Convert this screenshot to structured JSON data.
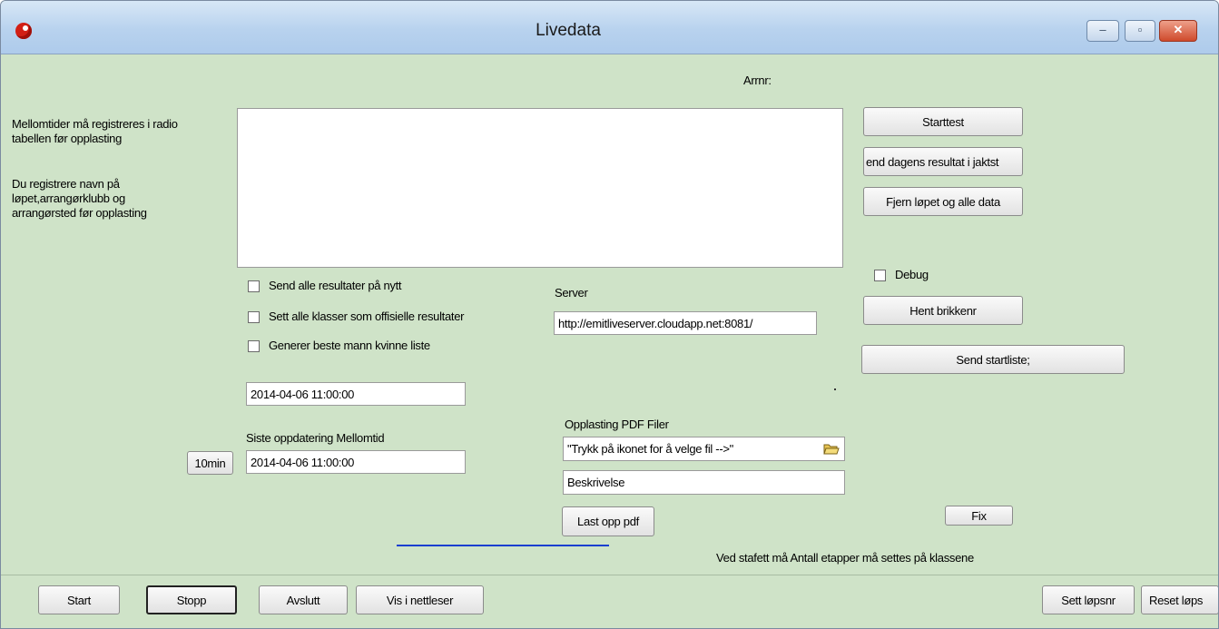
{
  "window": {
    "title": "Livedata",
    "controls": {
      "minimize": "‒",
      "maximize": "▫",
      "close": "✕"
    }
  },
  "header": {
    "arrnr_label": "Arrnr:"
  },
  "info": {
    "line1a": "Mellomtider må registreres i radio",
    "line1b": "tabellen før opplasting",
    "line2a": "Du registrere navn på",
    "line2b": "løpet,arrangørklubb og",
    "line2c": "arrangørsted før opplasting"
  },
  "right_buttons": {
    "starttest": "Starttest",
    "send_dagens": "end dagens resultat i jaktst",
    "fjern_lopet": "Fjern løpet og alle data",
    "debug_label": "Debug",
    "hent_brikkenr": "Hent brikkenr",
    "send_startliste": "Send startliste;",
    "fix": "Fix"
  },
  "options": {
    "send_alle": "Send alle resultater på nytt",
    "sett_alle": "Sett alle klasser som offisielle resultater",
    "generer_beste": "Generer beste mann kvinne liste"
  },
  "server": {
    "label": "Server",
    "value": "http://emitliveserver.cloudapp.net:8081/"
  },
  "times": {
    "first_value": "2014-04-06 11:00:00",
    "mellomtid_label": "Siste oppdatering Mellomtid",
    "mellomtid_value": "2014-04-06 11:00:00",
    "ten_min": "10min"
  },
  "pdf": {
    "label": "Opplasting PDF Filer",
    "file_value": "\"Trykk på ikonet for å velge fil -->\"",
    "description": "Beskrivelse",
    "upload": "Last opp pdf"
  },
  "stafett_note": "Ved stafett må Antall etapper må settes på klassene",
  "bottom_bar": {
    "start": "Start",
    "stopp": "Stopp",
    "avslutt": "Avslutt",
    "vis_nettleser": "Vis i nettleser",
    "sett_lopsnr": "Sett løpsnr",
    "reset_lops": "Reset løps"
  }
}
